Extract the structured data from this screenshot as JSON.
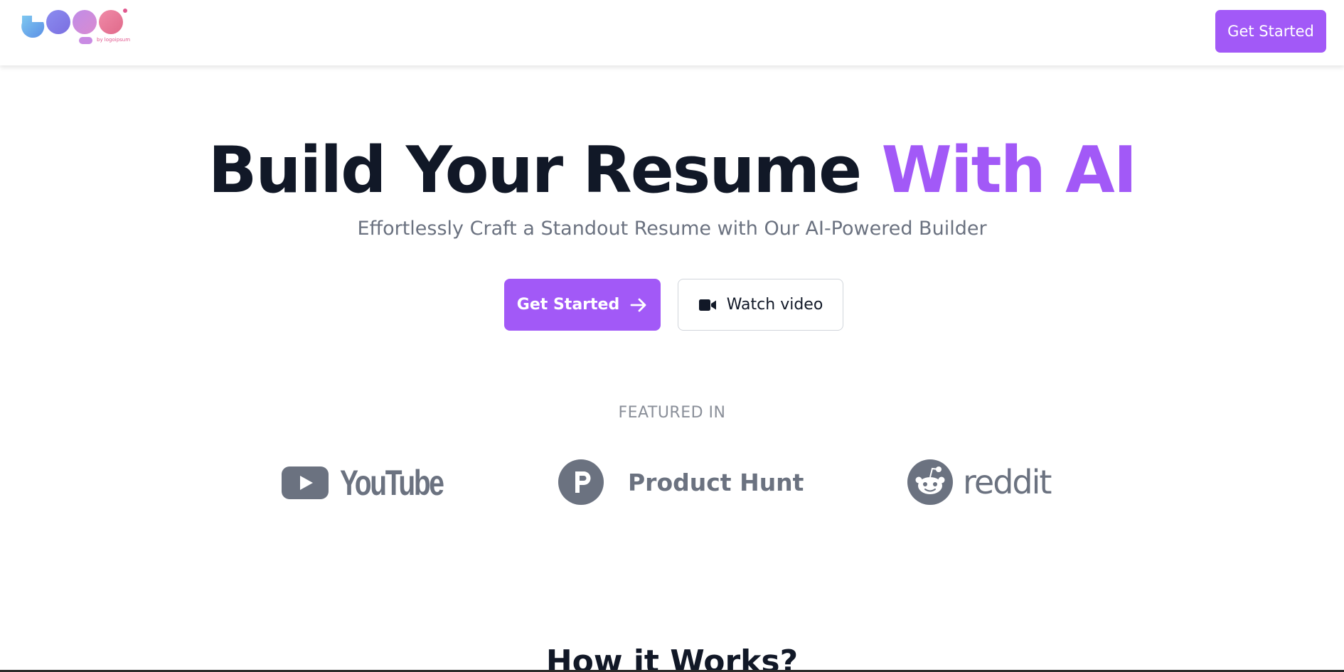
{
  "brand": {
    "logo_text": "Logo",
    "logo_sub": "by logoipsum"
  },
  "nav": {
    "cta_label": "Get Started"
  },
  "hero": {
    "title_main": "Build Your Resume ",
    "title_accent": "With AI",
    "subtitle": "Effortlessly Craft a Standout Resume with Our AI-Powered Builder",
    "primary_label": "Get Started",
    "secondary_label": "Watch video"
  },
  "featured": {
    "label": "FEATURED IN",
    "brands": [
      {
        "name": "YouTube",
        "icon": "youtube-icon"
      },
      {
        "name": "Product Hunt",
        "icon": "product-hunt-icon"
      },
      {
        "name": "reddit",
        "icon": "reddit-icon"
      }
    ]
  },
  "how": {
    "title": "How it Works?"
  },
  "colors": {
    "accent": "#a259f7",
    "text": "#111827",
    "muted": "#6b7280"
  }
}
